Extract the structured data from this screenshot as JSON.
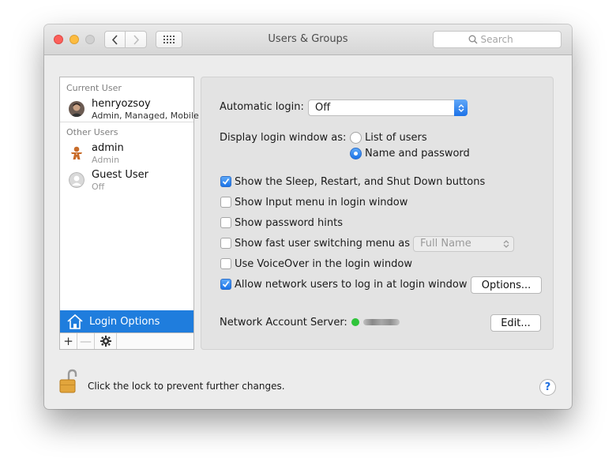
{
  "window": {
    "title": "Users & Groups"
  },
  "search": {
    "placeholder": "Search"
  },
  "sidebar": {
    "current_user_header": "Current User",
    "other_users_header": "Other Users",
    "users": [
      {
        "name": "henryozsoy",
        "detail": "Admin, Managed, Mobile",
        "icon": "user-photo-avatar"
      },
      {
        "name": "admin",
        "detail": "Admin",
        "icon": "gingerbread-avatar"
      },
      {
        "name": "Guest User",
        "detail": "Off",
        "icon": "guest-silhouette-avatar"
      }
    ],
    "login_options_label": "Login Options",
    "toolbar": {
      "add": "+",
      "remove": "—",
      "actions_icon": "gear-icon"
    }
  },
  "main": {
    "automatic_login_label": "Automatic login:",
    "automatic_login_value": "Off",
    "display_login_label": "Display login window as:",
    "display_options": [
      {
        "label": "List of users",
        "selected": false
      },
      {
        "label": "Name and password",
        "selected": true
      }
    ],
    "checkboxes": [
      {
        "label": "Show the Sleep, Restart, and Shut Down buttons",
        "checked": true
      },
      {
        "label": "Show Input menu in login window",
        "checked": false
      },
      {
        "label": "Show password hints",
        "checked": false
      },
      {
        "label": "Show fast user switching menu as",
        "checked": false
      },
      {
        "label": "Use VoiceOver in the login window",
        "checked": false
      },
      {
        "label": "Allow network users to log in at login window",
        "checked": true
      }
    ],
    "fast_switch_value": "Full Name",
    "options_button": "Options...",
    "network_server_label": "Network Account Server:",
    "network_server_status_color": "#2fc43a",
    "edit_button": "Edit..."
  },
  "footer": {
    "lock_text": "Click the lock to prevent further changes.",
    "help_label": "?"
  },
  "colors": {
    "accent": "#1f7ddd",
    "check_blue": "#1a73e8"
  }
}
